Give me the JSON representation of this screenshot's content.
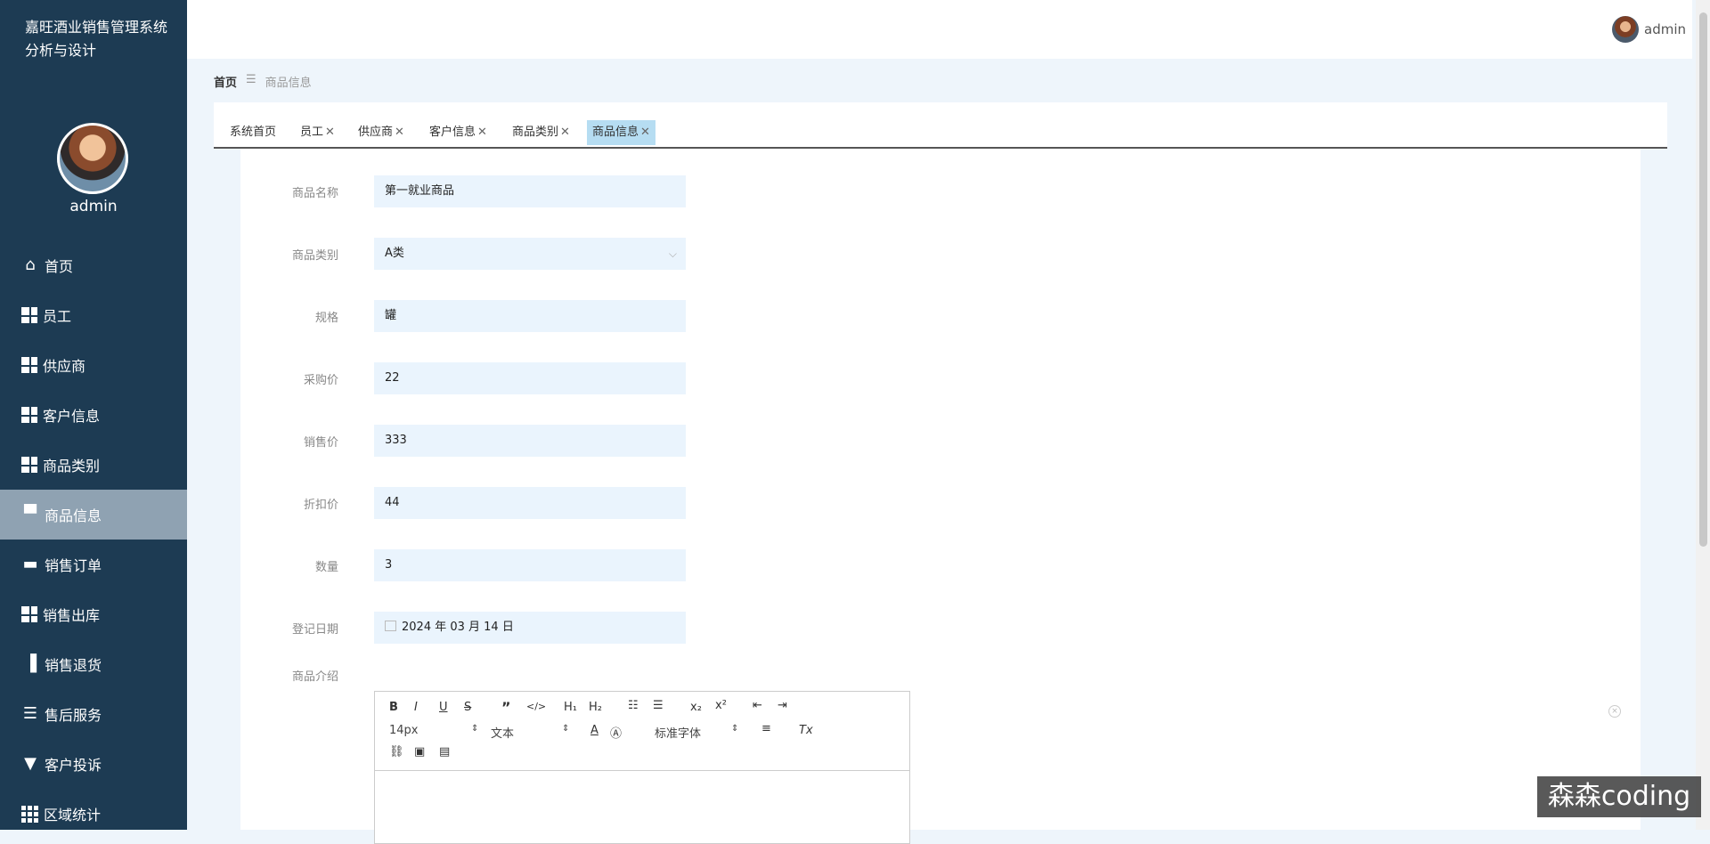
{
  "app": {
    "title": "嘉旺酒业销售管理系统分析与设计",
    "user": "admin"
  },
  "sidebar": {
    "user": "admin",
    "items": [
      {
        "label": "首页",
        "icon": "home-icon"
      },
      {
        "label": "员工",
        "icon": "grid-icon"
      },
      {
        "label": "供应商",
        "icon": "grid-icon"
      },
      {
        "label": "客户信息",
        "icon": "grid-icon"
      },
      {
        "label": "商品类别",
        "icon": "grid-icon"
      },
      {
        "label": "商品信息",
        "icon": "monitor-icon",
        "active": true
      },
      {
        "label": "销售订单",
        "icon": "printer-icon"
      },
      {
        "label": "销售出库",
        "icon": "grid-icon"
      },
      {
        "label": "销售退货",
        "icon": "bar-chart-icon"
      },
      {
        "label": "售后服务",
        "icon": "sliders-icon"
      },
      {
        "label": "客户投诉",
        "icon": "comment-icon"
      },
      {
        "label": "区域统计",
        "icon": "grid9-icon"
      }
    ]
  },
  "breadcrumb": {
    "home": "首页",
    "separator": "☰",
    "current": "商品信息"
  },
  "tabs": [
    {
      "label": "系统首页",
      "closable": false
    },
    {
      "label": "员工",
      "closable": true
    },
    {
      "label": "供应商",
      "closable": true
    },
    {
      "label": "客户信息",
      "closable": true
    },
    {
      "label": "商品类别",
      "closable": true
    },
    {
      "label": "商品信息",
      "closable": true,
      "active": true
    }
  ],
  "form": {
    "name": {
      "label": "商品名称",
      "value": "第一就业商品"
    },
    "category": {
      "label": "商品类别",
      "value": "A类"
    },
    "spec": {
      "label": "规格",
      "value": "罐"
    },
    "purchase_price": {
      "label": "采购价",
      "value": "22"
    },
    "sale_price": {
      "label": "销售价",
      "value": "333"
    },
    "discount_price": {
      "label": "折扣价",
      "value": "44"
    },
    "quantity": {
      "label": "数量",
      "value": "3"
    },
    "date": {
      "label": "登记日期",
      "value": "2024 年 03 月 14 日"
    },
    "intro": {
      "label": "商品介绍"
    }
  },
  "editor": {
    "font_size": "14px",
    "text_style": "文本",
    "font_family": "标准字体"
  },
  "watermark": "森森coding",
  "colors": {
    "sidebar": "#1d3b53",
    "active_menu": "#8fa2b2",
    "active_tab": "#b6ddf2",
    "input_bg": "#eaf4fd"
  }
}
